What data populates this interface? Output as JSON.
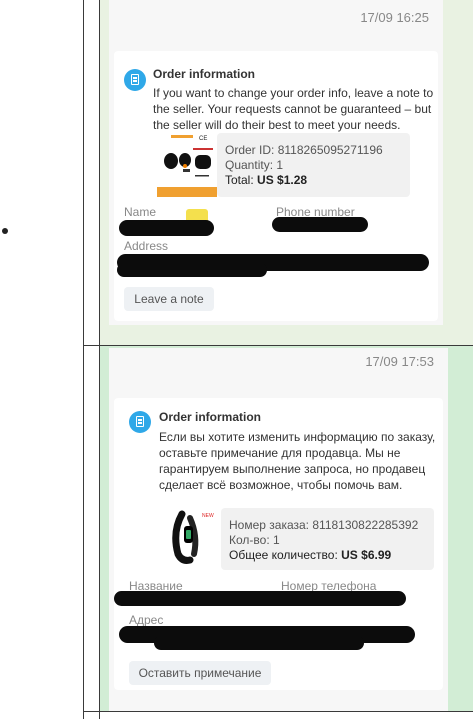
{
  "messages": [
    {
      "timestamp": "17/09 16:25",
      "title": "Order information",
      "description": "If you want to change your order info, leave a note to the seller. Your requests cannot be guaranteed – but the seller will do their best to meet your needs.",
      "order_id_label": "Order ID:",
      "order_id": "8118265095271196",
      "quantity_label": "Quantity:",
      "quantity": "1",
      "total_label": "Total:",
      "total": "US $1.28",
      "name_label": "Name",
      "phone_label": "Phone number",
      "address_label": "Address",
      "button_label": "Leave a note"
    },
    {
      "timestamp": "17/09 17:53",
      "title": "Order information",
      "description": "Если вы хотите изменить информацию по заказу, оставьте примечание для продавца. Мы не гарантируем выполнение запроса, но продавец сделает всё возможное, чтобы помочь вам.",
      "order_id_label": "Номер заказа:",
      "order_id": "8118130822285392",
      "quantity_label": "Кол-во:",
      "quantity": "1",
      "total_label": "Общее количество:",
      "total": "US $6.99",
      "name_label": "Название",
      "phone_label": "Номер телефона",
      "address_label": "Адрес",
      "button_label": "Оставить примечание"
    }
  ],
  "colors": {
    "cell1_bg": "#e9f2e2",
    "cell2_bg": "#d2edd5",
    "accent": "#2fa8e8"
  },
  "icons": [
    "info-doc-icon",
    "earbuds-product-image",
    "fitness-band-product-image"
  ]
}
